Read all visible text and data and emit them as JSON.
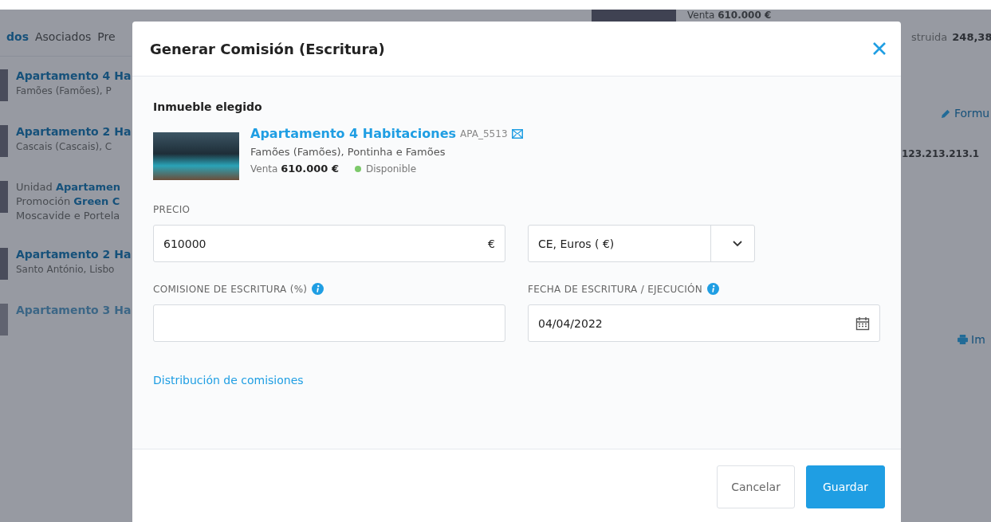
{
  "background": {
    "top_listing": {
      "price_label": "Venta",
      "price": "610.000 €"
    },
    "tabs": [
      {
        "label": "dos",
        "selected": true
      },
      {
        "label": "Asociados",
        "selected": false
      },
      {
        "label": "Pre",
        "selected": false
      }
    ],
    "listings": [
      {
        "kind": "property",
        "title": "Apartamento 4 Ha",
        "subtitle": "Famões (Famões), P",
        "dimmed": false
      },
      {
        "kind": "property",
        "title": "Apartamento 2 Ha",
        "subtitle": "Cascais (Cascais), C",
        "dimmed": false
      },
      {
        "kind": "unit",
        "lines": [
          "Unidad **Apartamen**",
          "Promoción **Green C**",
          "Moscavide e Portela"
        ],
        "dimmed": false
      },
      {
        "kind": "property",
        "title": "Apartamento 2 Ha",
        "subtitle": "Santo António, Lisbo",
        "dimmed": false
      },
      {
        "kind": "property",
        "title": "Apartamento 3 Ha",
        "dimmed": true
      }
    ],
    "right_panel": {
      "area_label": "struida",
      "area_value": "248,38",
      "form_link": "Formu",
      "code": "123.213.213.1",
      "print_link": "Im"
    }
  },
  "dialog": {
    "title": "Generar Comisión (Escritura)",
    "section_title": "Inmueble elegido",
    "property": {
      "title": "Apartamento 4 Habitaciones",
      "reference": "APA_5513",
      "location": "Famões (Famões), Pontinha e Famões",
      "price_label": "Venta",
      "price": "610.000 €",
      "status": "Disponible"
    },
    "price": {
      "label": "PRECIO",
      "value": "610000",
      "suffix": "€"
    },
    "currency": {
      "value": "CE, Euros ( €)"
    },
    "commission": {
      "label": "COMISIONE DE ESCRITURA (%)"
    },
    "date": {
      "label": "FECHA DE ESCRITURA / EJECUCIÓN",
      "value": "04/04/2022"
    },
    "distribution_link": "Distribución de comisiones",
    "buttons": [
      {
        "label": "Cancelar",
        "kind": "secondary"
      },
      {
        "label": "Guardar",
        "kind": "primary"
      }
    ]
  }
}
